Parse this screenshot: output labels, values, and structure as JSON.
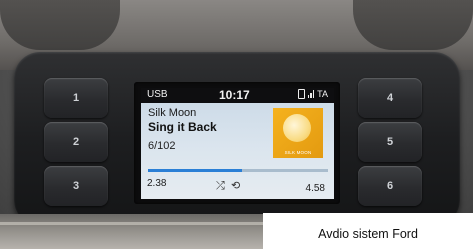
{
  "caption": "Avdio sistem Ford",
  "presets": {
    "left": [
      "1",
      "2",
      "3"
    ],
    "right": [
      "4",
      "5",
      "6"
    ]
  },
  "screen": {
    "source": "USB",
    "clock": "10:17",
    "status_text": "TA",
    "artist": "Silk Moon",
    "title": "Sing it Back",
    "track": "6/102",
    "album_art_label": "SILK MOON",
    "elapsed": "2.38",
    "total": "4.58",
    "progress": 0.52,
    "accent_color": "#2b7fd6",
    "icons": [
      "phone-icon",
      "signal-icon",
      "shuffle-icon",
      "repeat-icon"
    ]
  }
}
